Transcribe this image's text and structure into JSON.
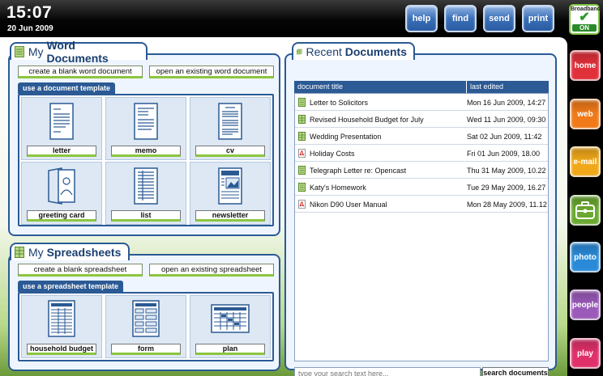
{
  "clock": {
    "time": "15:07",
    "date": "20 Jun 2009"
  },
  "topbar": {
    "buttons": [
      {
        "label": "help"
      },
      {
        "label": "find"
      },
      {
        "label": "send"
      },
      {
        "label": "print"
      }
    ],
    "broadband": {
      "label": "Broadband",
      "status": "ON"
    }
  },
  "sidebar": {
    "items": [
      {
        "label": "home",
        "color": "#e0303a"
      },
      {
        "label": "web",
        "color": "#f07a1a"
      },
      {
        "label": "e-mail",
        "color": "#f0a81a"
      },
      {
        "label": "",
        "icon": "briefcase-icon",
        "color": "#6aa830"
      },
      {
        "label": "photo",
        "color": "#2a8ad8"
      },
      {
        "label": "people",
        "color": "#9a5ab8"
      },
      {
        "label": "play",
        "color": "#e0306a"
      }
    ]
  },
  "word": {
    "title_light": "My ",
    "title_bold": "Word Documents",
    "blank_label": "create a blank word document",
    "open_label": "open an existing word document",
    "template_tab": "use a document template",
    "templates": [
      {
        "label": "letter",
        "icon": "letter-icon"
      },
      {
        "label": "memo",
        "icon": "memo-icon"
      },
      {
        "label": "cv",
        "icon": "cv-icon"
      },
      {
        "label": "greeting card",
        "icon": "greeting-card-icon"
      },
      {
        "label": "list",
        "icon": "list-icon"
      },
      {
        "label": "newsletter",
        "icon": "newsletter-icon"
      }
    ]
  },
  "sheets": {
    "title_light": "My ",
    "title_bold": "Spreadsheets",
    "blank_label": "create a blank spreadsheet",
    "open_label": "open an existing spreadsheet",
    "template_tab": "use a spreadsheet template",
    "templates": [
      {
        "label": "household budget",
        "icon": "household-budget-icon"
      },
      {
        "label": "form",
        "icon": "form-icon"
      },
      {
        "label": "plan",
        "icon": "plan-icon"
      }
    ]
  },
  "recent": {
    "title_light": "Recent ",
    "title_bold": "Documents",
    "col_title": "document title",
    "col_edited": "last edited",
    "rows": [
      {
        "title": "Letter to Solicitors",
        "date": "Mon 16 Jun 2009, 14:27",
        "type": "word"
      },
      {
        "title": "Revised Household Budget for July",
        "date": "Wed 11 Jun 2009, 09:30",
        "type": "sheet"
      },
      {
        "title": "Wedding Presentation",
        "date": "Sat 02 Jun 2009, 11:42",
        "type": "sheet"
      },
      {
        "title": "Holiday Costs",
        "date": "Fri 01 Jun 2009, 18.00",
        "type": "pdf"
      },
      {
        "title": "Telegraph Letter re: Opencast",
        "date": "Thu 31 May 2009, 10.22",
        "type": "word"
      },
      {
        "title": "Katy's Homework",
        "date": "Tue 29 May 2009, 16.27",
        "type": "word"
      },
      {
        "title": "Nikon D90 User Manual",
        "date": "Mon 28 May 2009, 11.12",
        "type": "pdf"
      }
    ],
    "search_placeholder": "type your search text here...",
    "search_button": "search documents"
  }
}
